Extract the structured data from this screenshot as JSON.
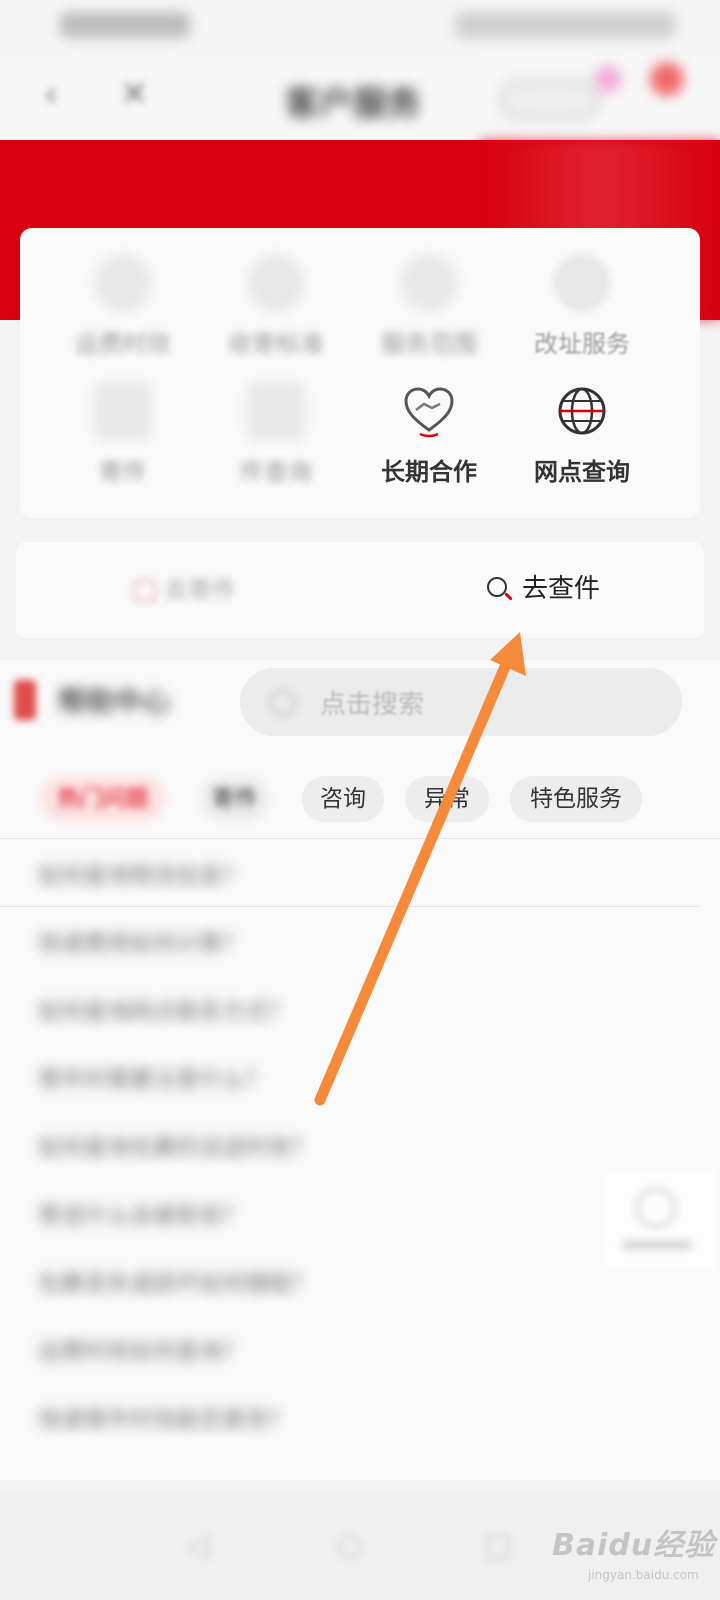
{
  "status_bar": {},
  "nav": {
    "back_glyph": "‹",
    "close_glyph": "✕",
    "title": "客户服务"
  },
  "services": [
    {
      "label": "运费时效",
      "icon": "clock-icon",
      "clear": false
    },
    {
      "label": "收寄标准",
      "icon": "box-icon",
      "clear": false
    },
    {
      "label": "服务范围",
      "icon": "location-icon",
      "clear": false
    },
    {
      "label": "改址服务",
      "icon": "address-change-icon",
      "clear": false
    },
    {
      "label": "寄件",
      "icon": "send-icon",
      "clear": false
    },
    {
      "label": "件查询",
      "icon": "parcel-search-icon",
      "clear": false
    },
    {
      "label": "长期合作",
      "icon": "handshake-icon",
      "clear": true
    },
    {
      "label": "网点查询",
      "icon": "globe-icon",
      "clear": true
    }
  ],
  "query": {
    "left_label": "去寄件",
    "right_label": "去查件"
  },
  "help": {
    "title": "帮助中心",
    "search_placeholder": "点击搜索",
    "chips": [
      {
        "label": "热门问题",
        "active": true
      },
      {
        "label": "寄件",
        "active": false
      },
      {
        "label": "咨询",
        "active": false
      },
      {
        "label": "异常",
        "active": false
      },
      {
        "label": "特色服务",
        "active": false
      }
    ],
    "faqs": [
      "如何查询物流信息？",
      "快递费用如何计算？",
      "如何查询网点联系方式？",
      "寄件时需要注意什么？",
      "如何查询包裹的派送时效？",
      "寄送什么会被拒收？",
      "包裹丢失或损坏如何理赔？",
      "运费时效如何查询？",
      "快递寄件时效能否更改？"
    ]
  },
  "bottom_nav": {
    "back_glyph": "◁",
    "home_glyph": "○",
    "recent_glyph": "□"
  },
  "watermark": {
    "main": "Baidu经验",
    "sub": "jingyan.baidu.com"
  },
  "colors": {
    "brand_red": "#d7000f",
    "annotation_arrow": "#f58a3a"
  }
}
